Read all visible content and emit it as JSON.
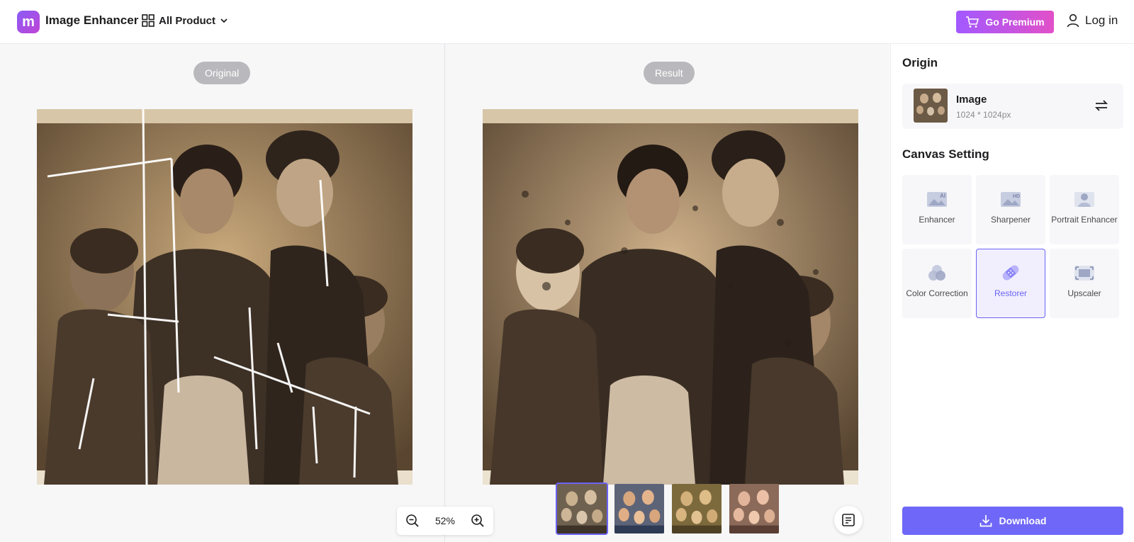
{
  "header": {
    "app_title": "Image Enhancer",
    "all_product_label": "All Product",
    "premium_label": "Go Premium",
    "login_label": "Log in",
    "logo_letter": "m"
  },
  "compare": {
    "original_label": "Original",
    "result_label": "Result"
  },
  "zoom": {
    "value": "52%"
  },
  "thumbnails": [
    {
      "tone": "#6f6150",
      "selected": true
    },
    {
      "tone": "#5d6478",
      "selected": false
    },
    {
      "tone": "#7c6a3d",
      "selected": false
    },
    {
      "tone": "#8c6a5a",
      "selected": false
    }
  ],
  "sidebar": {
    "origin_title": "Origin",
    "origin_name": "Image",
    "origin_size": "1024 * 1024px",
    "canvas_title": "Canvas Setting",
    "tools": [
      {
        "label": "Enhancer",
        "icon": "ai-image-icon",
        "active": false
      },
      {
        "label": "Sharpener",
        "icon": "hd-image-icon",
        "active": false
      },
      {
        "label": "Portrait Enhancer",
        "icon": "portrait-icon",
        "active": false
      },
      {
        "label": "Color Correction",
        "icon": "color-circles-icon",
        "active": false
      },
      {
        "label": "Restorer",
        "icon": "bandage-icon",
        "active": true
      },
      {
        "label": "Upscaler",
        "icon": "upscale-icon",
        "active": false
      }
    ],
    "download_label": "Download"
  },
  "colors": {
    "accent": "#6f67f7",
    "premium_gradient_start": "#a259ff",
    "premium_gradient_end": "#e150c8"
  }
}
